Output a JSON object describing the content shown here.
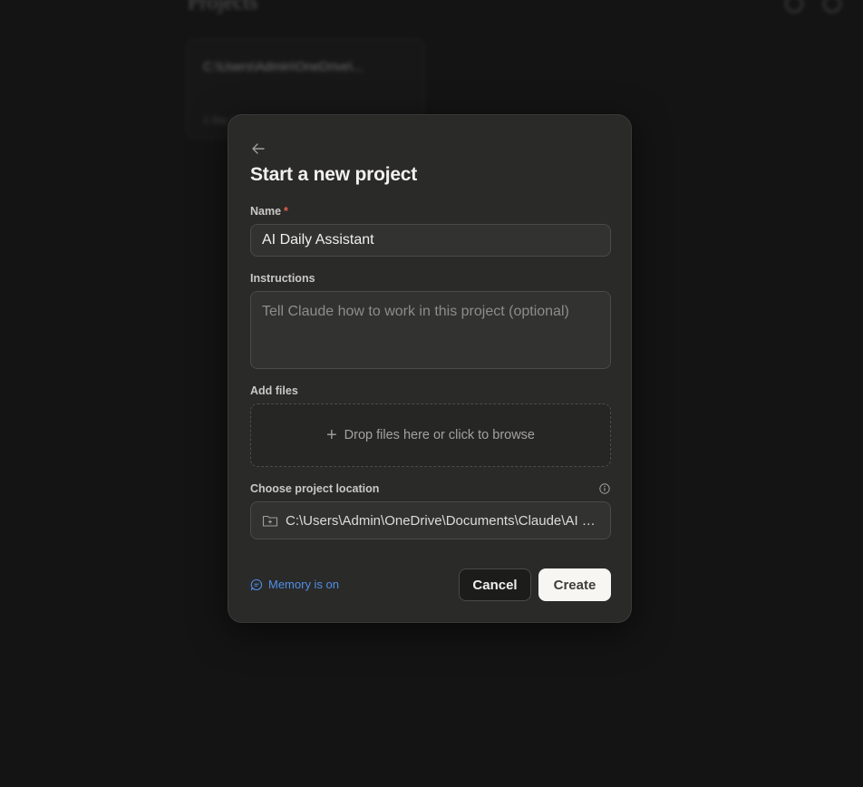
{
  "background": {
    "page_title": "Projects",
    "card_title": "C:\\Users\\Admin\\OneDrive\\...",
    "card_subtitle": "1 day ago"
  },
  "modal": {
    "title": "Start a new project",
    "back_icon": "arrow-left-icon",
    "name": {
      "label": "Name",
      "required_marker": "*",
      "value": "AI Daily Assistant"
    },
    "instructions": {
      "label": "Instructions",
      "placeholder": "Tell Claude how to work in this project (optional)",
      "value": ""
    },
    "files": {
      "label": "Add files",
      "dropzone_text": "Drop files here or click to browse",
      "icon": "plus-icon"
    },
    "location": {
      "label": "Choose project location",
      "info_icon": "info-icon",
      "folder_icon": "folder-plus-icon",
      "path": "C:\\Users\\Admin\\OneDrive\\Documents\\Claude\\AI Daily Assistant"
    },
    "memory": {
      "label": "Memory is on",
      "icon": "memory-icon",
      "color": "#4f8fe6"
    },
    "buttons": {
      "cancel": "Cancel",
      "create": "Create"
    }
  },
  "colors": {
    "backdrop": "#141414",
    "modal_bg": "#2a2a29",
    "input_bg": "#323231",
    "required": "#e0614f",
    "primary_button_bg": "#f7f6f2"
  }
}
